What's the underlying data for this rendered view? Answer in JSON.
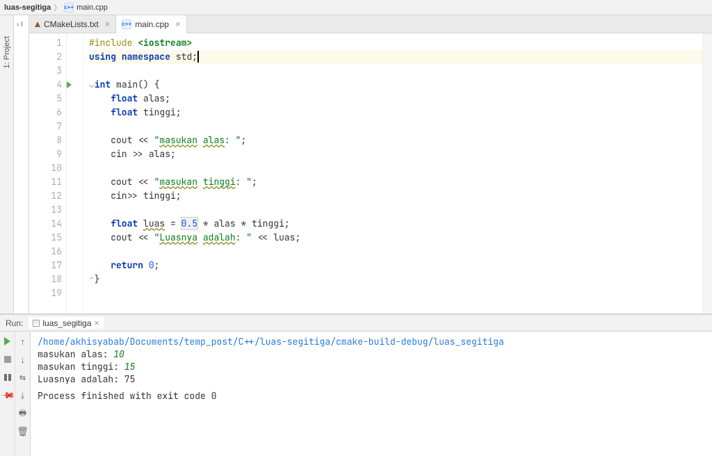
{
  "breadcrumb": {
    "project": "luas-segitiga",
    "file": "main.cpp",
    "file_icon_text": "c++"
  },
  "sidebar": {
    "project_label": "1: Project"
  },
  "tabs": [
    {
      "label": "CMakeLists.txt",
      "icon": "cmake",
      "active": false
    },
    {
      "label": "main.cpp",
      "icon": "cpp",
      "active": true
    }
  ],
  "code": {
    "line_count": 19,
    "run_marker_line": 4,
    "highlight_line": 2,
    "lines": {
      "l1_kw": "#include",
      "l1_inc": "<iostream>",
      "l2_kw1": "using",
      "l2_kw2": "namespace",
      "l2_ns": "std",
      "l4_kw": "int",
      "l4_fn": "main",
      "l5_kw": "float",
      "l5_var": "alas",
      "l6_kw": "float",
      "l6_var": "tinggi",
      "l8_obj": "cout",
      "l8_str_a": "\"",
      "l8_str_b": "masukan",
      "l8_str_c": " ",
      "l8_str_d": "alas",
      "l8_str_e": ": \"",
      "l9_obj": "cin",
      "l9_var": "alas",
      "l11_obj": "cout",
      "l11_str_a": "\"",
      "l11_str_b": "masukan",
      "l11_str_c": " ",
      "l11_str_d": "tinggi",
      "l11_str_e": ": \"",
      "l12_obj": "cin",
      "l12_var": "tinggi",
      "l14_kw": "float",
      "l14_var": "luas",
      "l14_num": "0.5",
      "l14_v2": "alas",
      "l14_v3": "tinggi",
      "l15_obj": "cout",
      "l15_str_a": "\"",
      "l15_str_b": "Luasnya",
      "l15_str_c": " ",
      "l15_str_d": "adalah",
      "l15_str_e": ": \"",
      "l15_var": "luas",
      "l17_kw": "return",
      "l17_val": "0"
    }
  },
  "run": {
    "title": "Run:",
    "config": "luas_segitiga",
    "console": {
      "path": "/home/akhisyabab/Documents/temp_post/C++/luas-segitiga/cmake-build-debug/luas_segitiga",
      "p1_label": "masukan alas: ",
      "p1_value": "10",
      "p2_label": "masukan tinggi: ",
      "p2_value": "15",
      "result": "Luasnya adalah: 75",
      "exit": "Process finished with exit code 0"
    }
  }
}
